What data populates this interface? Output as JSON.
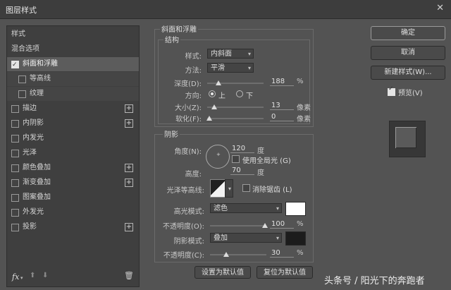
{
  "window": {
    "title": "图层样式",
    "close": "✕"
  },
  "sidebar": {
    "items": [
      {
        "label": "样式",
        "checkbox": false,
        "checked": false,
        "plus": false
      },
      {
        "label": "混合选项",
        "checkbox": false,
        "checked": false,
        "plus": false
      },
      {
        "label": "斜面和浮雕",
        "checkbox": true,
        "checked": true,
        "plus": false
      },
      {
        "label": "等高线",
        "checkbox": true,
        "checked": false,
        "plus": false
      },
      {
        "label": "纹理",
        "checkbox": true,
        "checked": false,
        "plus": false
      },
      {
        "label": "描边",
        "checkbox": true,
        "checked": false,
        "plus": true
      },
      {
        "label": "内阴影",
        "checkbox": true,
        "checked": false,
        "plus": true
      },
      {
        "label": "内发光",
        "checkbox": true,
        "checked": false,
        "plus": false
      },
      {
        "label": "光泽",
        "checkbox": true,
        "checked": false,
        "plus": false
      },
      {
        "label": "颜色叠加",
        "checkbox": true,
        "checked": false,
        "plus": true
      },
      {
        "label": "渐变叠加",
        "checkbox": true,
        "checked": false,
        "plus": true
      },
      {
        "label": "图案叠加",
        "checkbox": true,
        "checked": false,
        "plus": false
      },
      {
        "label": "外发光",
        "checkbox": true,
        "checked": false,
        "plus": false
      },
      {
        "label": "投影",
        "checkbox": true,
        "checked": false,
        "plus": true
      }
    ],
    "bottom": {
      "fx": "fx",
      "fx_arrow": "▾",
      "up": "⬆",
      "down": "⬇",
      "trash": "🗑"
    }
  },
  "bevel": {
    "section_title": "斜面和浮雕",
    "structure_title": "结构",
    "style_label": "样式:",
    "style_value": "内斜面",
    "technique_label": "方法:",
    "technique_value": "平滑",
    "depth_label": "深度(D):",
    "depth_value": "188",
    "depth_unit": "%",
    "direction_label": "方向:",
    "direction_up": "上",
    "direction_down": "下",
    "size_label": "大小(Z):",
    "size_value": "13",
    "size_unit": "像素",
    "soften_label": "软化(F):",
    "soften_value": "0",
    "soften_unit": "像素"
  },
  "shading": {
    "title": "阴影",
    "angle_label": "角度(N):",
    "angle_value": "120",
    "angle_unit": "度",
    "global_light_label": "使用全局光 (G)",
    "altitude_label": "高度:",
    "altitude_value": "70",
    "altitude_unit": "度",
    "gloss_label": "光泽等高线:",
    "antialias_label": "消除锯齿 (L)",
    "highlight_mode_label": "高光模式:",
    "highlight_mode_value": "滤色",
    "highlight_opacity_label": "不透明度(O):",
    "highlight_opacity_value": "100",
    "highlight_opacity_unit": "%",
    "shadow_mode_label": "阴影模式:",
    "shadow_mode_value": "叠加",
    "shadow_opacity_label": "不透明度(C):",
    "shadow_opacity_value": "30",
    "shadow_opacity_unit": "%"
  },
  "buttons": {
    "make_default": "设置为默认值",
    "reset_default": "复位为默认值",
    "ok": "确定",
    "cancel": "取消",
    "new_style": "新建样式(W)...",
    "preview": "预览(V)"
  },
  "colors": {
    "highlight": "#ffffff",
    "shadow": "#1c1c1c"
  },
  "watermark": "头条号 / 阳光下的奔跑者"
}
